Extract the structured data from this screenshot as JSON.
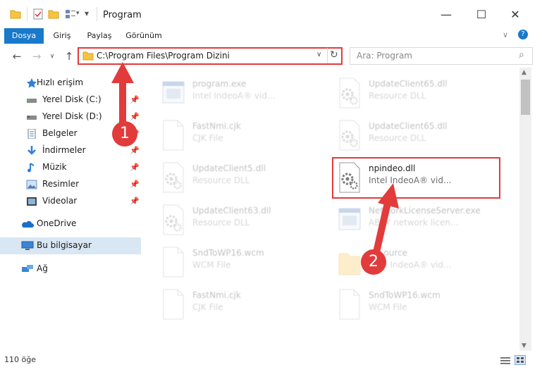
{
  "window": {
    "title": "Program",
    "minimize": "—",
    "maximize": "☐",
    "close": "✕"
  },
  "ribbon": {
    "tabs": [
      "Dosya",
      "Giriş",
      "Paylaş",
      "Görünüm"
    ],
    "expand": "∨",
    "help": "?"
  },
  "nav": {
    "back": "←",
    "forward": "→",
    "recent": "∨",
    "up": "↑",
    "address": "C:\\Program Files\\Program Dizini",
    "dropdown": "∨",
    "refresh": "↻",
    "search_placeholder": "Ara: Program",
    "search_icon": "⌕"
  },
  "sidebar": {
    "items": [
      {
        "label": "Hızlı erişim",
        "icon": "star-icon"
      },
      {
        "label": "Yerel Disk (C:)",
        "icon": "drive-icon",
        "pinned": true
      },
      {
        "label": "Yerel Disk (D:)",
        "icon": "drive-icon",
        "pinned": true
      },
      {
        "label": "Belgeler",
        "icon": "documents-icon",
        "pinned": true
      },
      {
        "label": "İndirmeler",
        "icon": "download-icon",
        "pinned": true
      },
      {
        "label": "Müzik",
        "icon": "music-icon",
        "pinned": true
      },
      {
        "label": "Resimler",
        "icon": "pictures-icon",
        "pinned": true
      },
      {
        "label": "Videolar",
        "icon": "videos-icon",
        "pinned": true
      },
      {
        "label": "OneDrive",
        "icon": "onedrive-icon"
      },
      {
        "label": "Bu bilgisayar",
        "icon": "computer-icon"
      },
      {
        "label": "Ağ",
        "icon": "network-icon"
      }
    ]
  },
  "files": {
    "col1": [
      {
        "name": "program.exe",
        "type": "Intel IndeoA® vid..."
      },
      {
        "name": "FastNmi.cjk",
        "type": "CJK File"
      },
      {
        "name": "UpdateClient5.dll",
        "type": "Resource DLL"
      },
      {
        "name": "UpdateClient63.dll",
        "type": "Resource DLL"
      },
      {
        "name": "SndToWP16.wcm",
        "type": "WCM File"
      },
      {
        "name": "FastNmi.cjk",
        "type": "CJK File"
      }
    ],
    "col2": [
      {
        "name": "UpdateClient65.dll",
        "type": "Resource DLL"
      },
      {
        "name": "UpdateClient65.dll",
        "type": "Resource DLL"
      },
      {
        "name": "npindeo.dll",
        "type": "Intel IndeoA® vid..."
      },
      {
        "name": "NetworkLicenseServer.exe",
        "type": "ABBY network licen..."
      },
      {
        "name": "Resource",
        "type": "Intel IndeoA® vid..."
      },
      {
        "name": "SndToWP16.wcm",
        "type": "WCM File"
      }
    ]
  },
  "status": {
    "count": "110 öğe"
  },
  "annotations": {
    "step1": "1",
    "step2": "2",
    "color": "#e23b3b"
  }
}
